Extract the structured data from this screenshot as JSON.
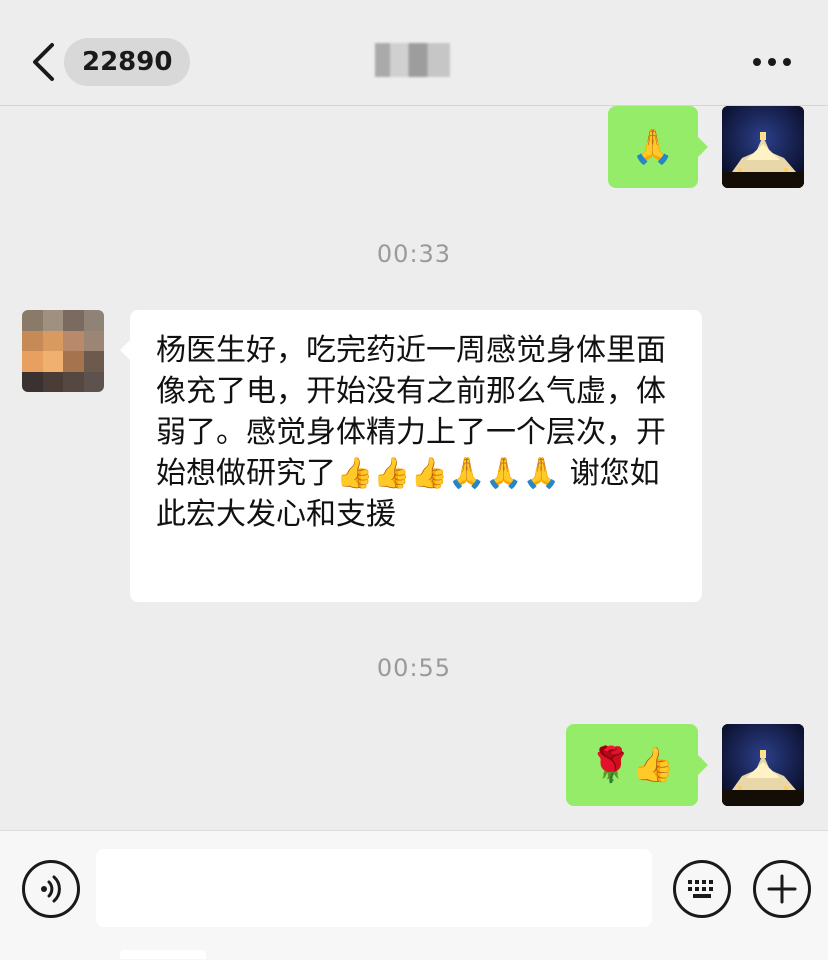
{
  "header": {
    "unread_count": "22890"
  },
  "messages": {
    "m1": {
      "emoji": "🙏"
    },
    "t1": "00:33",
    "m2": {
      "text": "杨医生好，吃完药近一周感觉身体里面像充了电，开始没有之前那么气虚，体弱了。感觉身体精力上了一个层次，开始想做研究了👍👍👍🙏🙏🙏 谢您如此宏大发心和支援"
    },
    "t2": "00:55",
    "m3": {
      "emoji": "🌹👍"
    }
  },
  "colors": {
    "self_bubble": "#95ec69",
    "other_bubble": "#ffffff",
    "background": "#ededed"
  },
  "icons": {
    "back": "chevron-left-icon",
    "more": "more-dots-icon",
    "voice": "voice-icon",
    "keyboard": "keyboard-icon",
    "plus": "plus-icon"
  }
}
